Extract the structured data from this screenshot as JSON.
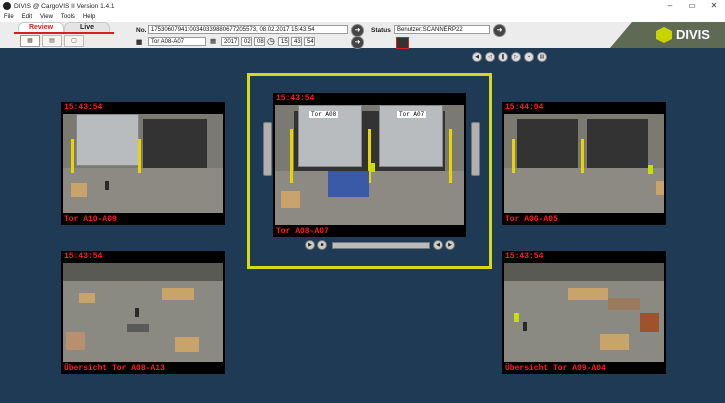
{
  "app": {
    "title": "DIVIS @ CargoVIS II Version 1.4.1"
  },
  "window_controls": {
    "minimize": "–",
    "maximize": "▭",
    "close": "✕"
  },
  "menu": [
    "File",
    "Edit",
    "View",
    "Tools",
    "Help"
  ],
  "modes": {
    "review": "Review",
    "live": "Live"
  },
  "toolbar": {
    "no_label": "No.",
    "no_value": "17530607941:00340339880677205573, 08.02.2017 15:43:54",
    "status_label": "Status",
    "status_value": "Benutzer:SCANNERP22",
    "gate_value": "Tor A08-A07",
    "date": {
      "year": "2017",
      "month": "02",
      "day": "08"
    },
    "time": {
      "h": "15",
      "m": "43",
      "s": "54"
    }
  },
  "logo": {
    "text": "DIVIS",
    "color": "#c8d400"
  },
  "cameras": {
    "top_left": {
      "timestamp": "15:43:54",
      "label": "Tor A10-A09"
    },
    "center": {
      "timestamp": "15:43:54",
      "label": "Tor A08-A07",
      "sign_left": "Tor A08",
      "sign_right": "Tor A07"
    },
    "top_right": {
      "timestamp": "15:44:04",
      "label": "Tor A06-A05"
    },
    "bottom_left": {
      "timestamp": "15:43:54",
      "label": "Übersicht Tor A08-A13"
    },
    "bottom_right": {
      "timestamp": "15:43:54",
      "label": "Übersicht Tor A09-A04"
    }
  },
  "colors": {
    "background": "#1e3a55",
    "timestamp": "#ff1e1e",
    "highlight": "#d4dc1a",
    "review_tab": "#d62020"
  }
}
